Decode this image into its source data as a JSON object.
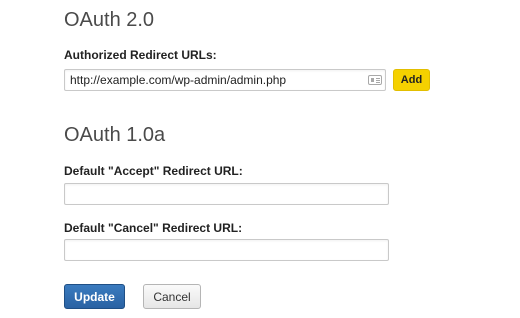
{
  "oauth2": {
    "heading": "OAuth 2.0",
    "redirect_label": "Authorized Redirect URLs:",
    "redirect_value": "http://example.com/wp-admin/admin.php",
    "add_label": "Add"
  },
  "oauth1": {
    "heading": "OAuth 1.0a",
    "accept_label": "Default \"Accept\" Redirect URL:",
    "accept_value": "",
    "cancel_label": "Default \"Cancel\" Redirect URL:",
    "cancel_value": ""
  },
  "actions": {
    "update_label": "Update",
    "cancel_label": "Cancel"
  },
  "icons": {
    "redirect_field_icon": "contact-card-icon"
  },
  "colors": {
    "add_button": "#f5d100",
    "update_button": "#2f6db0"
  }
}
